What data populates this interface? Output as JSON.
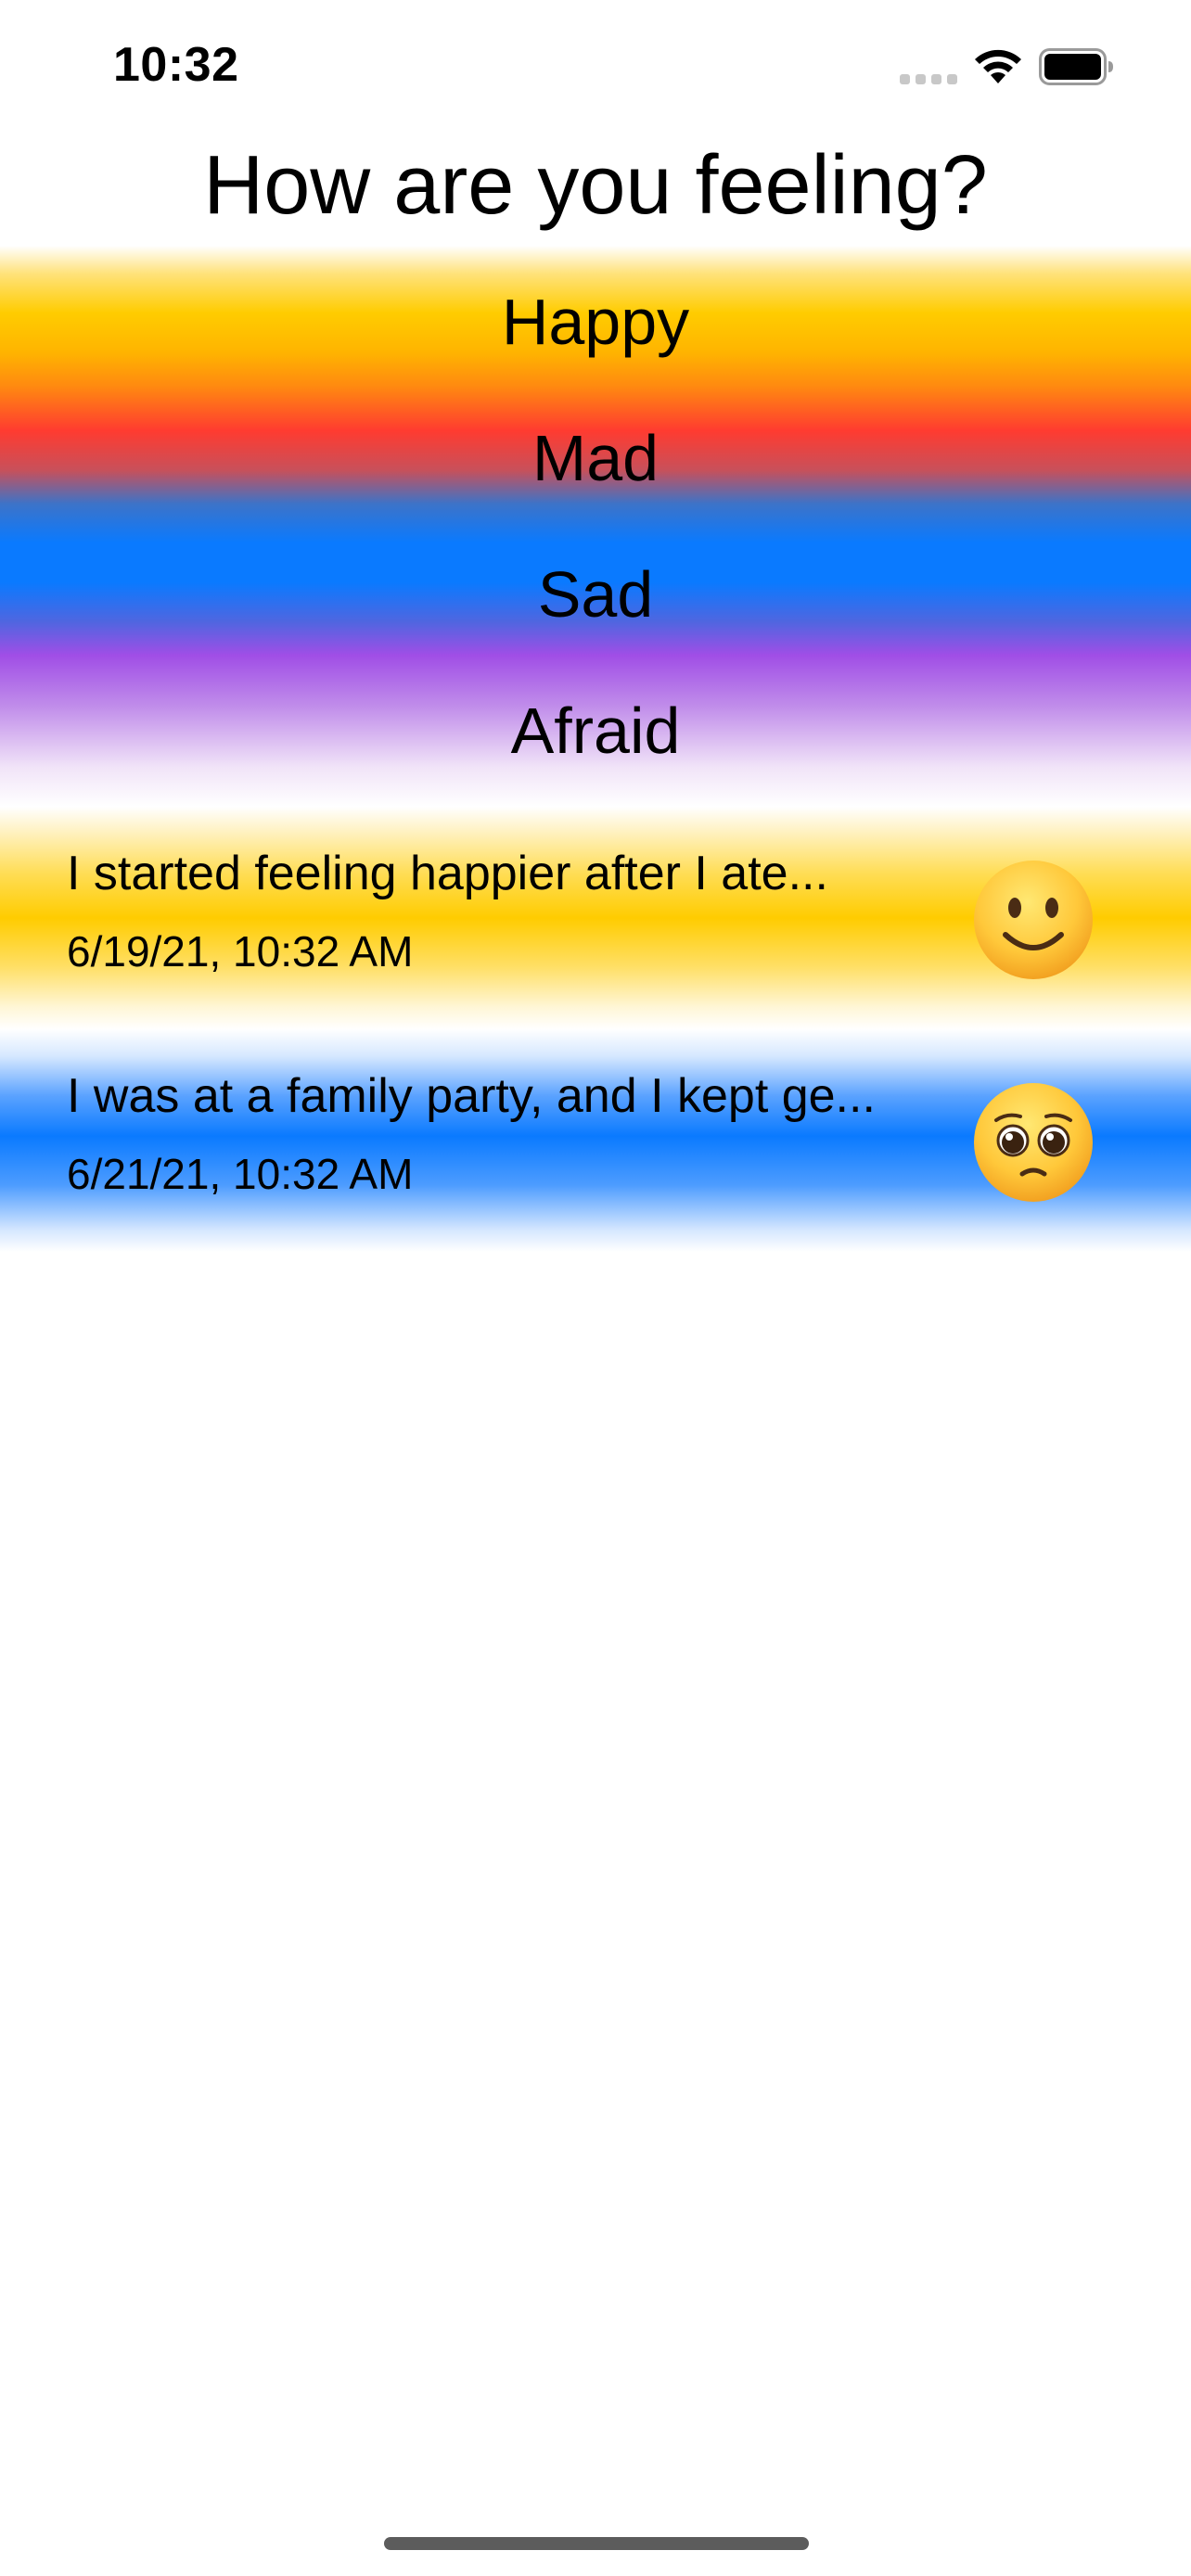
{
  "status_bar": {
    "time": "10:32",
    "icons": [
      "cellular-signal-icon",
      "wifi-icon",
      "battery-icon"
    ]
  },
  "title": "How are you feeling?",
  "emotions": [
    {
      "label": "Happy",
      "color": "#ffcc00"
    },
    {
      "label": "Mad",
      "color": "#ff3b30"
    },
    {
      "label": "Sad",
      "color": "#0a7aff"
    },
    {
      "label": "Afraid",
      "color": "#a04ee6"
    }
  ],
  "entries": [
    {
      "text": "I started feeling happier after I ate...",
      "date": "6/19/21, 10:32 AM",
      "emoji": "slightly-smiling-face-icon",
      "color": "#ffcc00"
    },
    {
      "text": "I was at a family party, and I kept ge...",
      "date": "6/21/21, 10:32 AM",
      "emoji": "pleading-face-icon",
      "color": "#0a7aff"
    }
  ]
}
